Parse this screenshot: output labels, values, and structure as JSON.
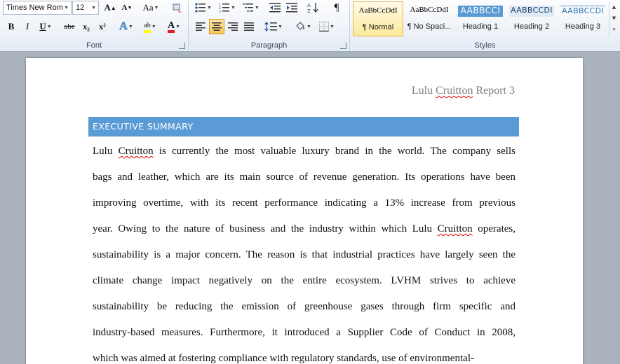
{
  "font_group": {
    "label": "Font",
    "font_name": "Times New Rom",
    "font_size": "12",
    "grow_font": "A",
    "shrink_font": "A",
    "change_case": "Aa",
    "bold": "B",
    "italic": "I",
    "underline": "U",
    "strikethrough": "abe",
    "subscript": "x₂",
    "superscript": "x²",
    "text_effects": "A",
    "highlight": "ab",
    "font_color": "A"
  },
  "paragraph_group": {
    "label": "Paragraph",
    "pilcrow": "¶"
  },
  "styles_group": {
    "label": "Styles",
    "items": [
      {
        "sample": "AaBbCcDdI",
        "name": "¶ Normal"
      },
      {
        "sample": "AaBbCcDdI",
        "name": "¶ No Spaci..."
      },
      {
        "sample": "AABBCCI",
        "name": "Heading 1"
      },
      {
        "sample": "AABBCCDI",
        "name": "Heading 2"
      },
      {
        "sample": "AABBCCDI",
        "name": "Heading 3"
      }
    ]
  },
  "document": {
    "header_name": "Lulu",
    "header_squiggle": "Cruitton",
    "header_rest": "Report 3",
    "heading": "EXECUTIVE SUMMARY",
    "lines": [
      [
        "Lulu ",
        "Cruitton",
        " is currently the most valuable luxury brand in the world. The company sells"
      ],
      [
        "bags and leather, which are its main source of revenue generation. Its operations have been"
      ],
      [
        "improving overtime, with its recent performance indicating a 13% increase from previous"
      ],
      [
        "year. Owing to the nature of business and the industry within which Lulu ",
        "Cruitton",
        " operates,"
      ],
      [
        "sustainability is a major concern. The reason is that industrial practices have largely seen the"
      ],
      [
        "climate change impact negatively on the entire ecosystem. LVHM strives to achieve"
      ],
      [
        "sustainability be reducing the emission of greenhouse gases through firm specific and"
      ],
      [
        "industry-based measures. Furthermore, it introduced a Supplier Code of Conduct in 2008,"
      ],
      [
        "which was aimed at fostering compliance with regulatory standards, use of environmental-"
      ]
    ]
  },
  "colors": {
    "heading_bar": "#5b9bd5",
    "selected_style": "#fde99a",
    "workspace": "#a9b2bd"
  }
}
